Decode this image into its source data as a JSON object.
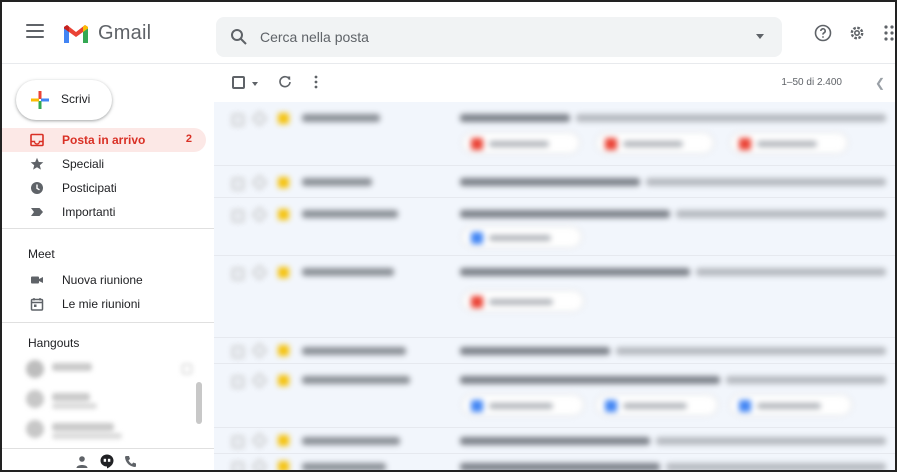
{
  "app": {
    "name": "Gmail"
  },
  "search": {
    "placeholder": "Cerca nella posta"
  },
  "compose": {
    "label": "Scrivi"
  },
  "sidebar": {
    "items": [
      {
        "label": "Posta in arrivo",
        "count": "2",
        "icon": "inbox-icon",
        "active": true
      },
      {
        "label": "Speciali",
        "icon": "star-icon"
      },
      {
        "label": "Posticipati",
        "icon": "clock-icon"
      },
      {
        "label": "Importanti",
        "icon": "important-icon"
      }
    ],
    "meet": {
      "title": "Meet",
      "items": [
        {
          "label": "Nuova riunione",
          "icon": "video-icon"
        },
        {
          "label": "Le mie riunioni",
          "icon": "calendar-icon"
        }
      ]
    },
    "hangouts": {
      "title": "Hangouts"
    }
  },
  "toolbar": {
    "pagination": "1–50 di 2.400"
  },
  "colors": {
    "accent": "#d93025",
    "active_bg": "#fce8e6",
    "row_bg": "#f2f6fc",
    "important": "#f4c20d",
    "attachment_red": "#ea4335",
    "attachment_blue": "#4285f4"
  }
}
